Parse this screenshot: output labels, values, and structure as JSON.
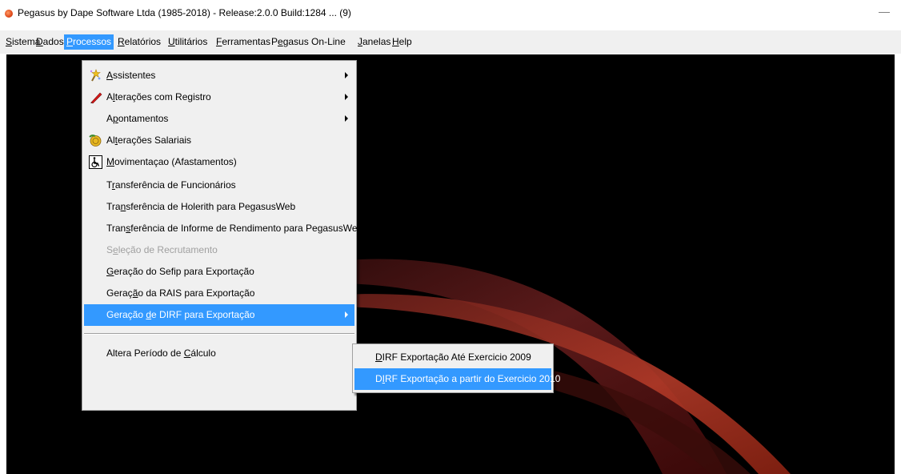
{
  "window": {
    "title": "Pegasus by Dape Software Ltda (1985-2018) - Release:2.0.0  Build:1284 ... (9)",
    "minimize_glyph": "—"
  },
  "menubar": {
    "items": [
      {
        "ul": "S",
        "rest": "istema"
      },
      {
        "ul": "D",
        "rest": "ados"
      },
      {
        "ul": "P",
        "rest": "rocessos"
      },
      {
        "ul": "R",
        "rest": "elatórios"
      },
      {
        "ul": "U",
        "rest": "tilitários"
      },
      {
        "ul": "F",
        "rest": "erramentas"
      },
      {
        "pre": "P",
        "ul": "e",
        "rest": "gasus On-Line"
      },
      {
        "ul": "J",
        "rest": "anelas"
      },
      {
        "ul": "H",
        "rest": "elp"
      }
    ]
  },
  "dropdown": {
    "items": [
      {
        "ul": "A",
        "rest": "ssistentes",
        "icon": "wizard-icon",
        "submenu": true
      },
      {
        "pre": "A",
        "ul": "l",
        "rest": "terações com Registro",
        "icon": "pencil-icon",
        "submenu": true
      },
      {
        "pre": "A",
        "ul": "p",
        "rest": "ontamentos",
        "submenu": true
      },
      {
        "pre": "Al",
        "ul": "t",
        "rest": "erações Salariais",
        "icon": "money-icon"
      },
      {
        "ul": "M",
        "rest": "ovimentaçao (Afastamentos)",
        "icon": "wheelchair-icon"
      },
      {
        "pre": "T",
        "ul": "r",
        "rest": "ansferência de Funcionários"
      },
      {
        "pre": "Tra",
        "ul": "n",
        "rest": "sferência de Holerith para PegasusWeb"
      },
      {
        "pre": "Tran",
        "ul": "s",
        "rest": "ferência de Informe de Rendimento para PegasusWeb"
      },
      {
        "pre": "S",
        "ul": "e",
        "rest": "leção de Recrutamento",
        "disabled": true
      },
      {
        "ul": "G",
        "rest": "eração do Sefip para Exportação"
      },
      {
        "pre": "Geraç",
        "ul": "ã",
        "rest": "o da RAIS para Exportação"
      },
      {
        "pre": "Geração ",
        "ul": "d",
        "rest": "e DIRF para Exportação",
        "submenu": true,
        "selected": true
      },
      {
        "pre": "Altera Período de ",
        "ul": "C",
        "rest": "álculo"
      }
    ]
  },
  "submenu": {
    "items": [
      {
        "ul": "D",
        "rest": "IRF Exportação Até Exercicio 2009"
      },
      {
        "pre": "D",
        "ul": "I",
        "rest": "RF Exportação a partir do Exercicio 2010",
        "selected": true
      }
    ]
  }
}
